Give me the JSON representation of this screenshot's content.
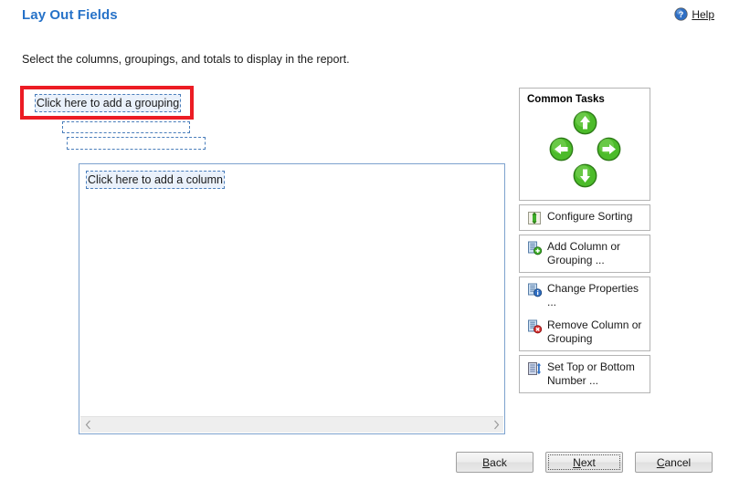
{
  "header": {
    "title": "Lay Out Fields",
    "help_label": "Help",
    "help_accel": "H",
    "help_icon": "help-circle-icon"
  },
  "instruction": "Select the columns, groupings, and totals to display in the report.",
  "designer": {
    "grouping_placeholder": "Click here to add a grouping",
    "grouping_empty_1": "",
    "grouping_empty_2": "",
    "column_placeholder": "Click here to add a column",
    "scroll_left_icon": "chevron-left-icon",
    "scroll_right_icon": "chevron-right-icon"
  },
  "annotation": {
    "color": "#ec1c24",
    "target": "grouping-placeholder"
  },
  "common_tasks": {
    "title": "Common Tasks",
    "arrows": [
      {
        "name": "move-up-button",
        "icon": "arrow-up-icon",
        "direction": "up"
      },
      {
        "name": "move-left-button",
        "icon": "arrow-left-icon",
        "direction": "left"
      },
      {
        "name": "move-right-button",
        "icon": "arrow-right-icon",
        "direction": "right"
      },
      {
        "name": "move-down-button",
        "icon": "arrow-down-icon",
        "direction": "down"
      }
    ],
    "items": [
      {
        "label": "Configure Sorting",
        "icon": "sort-icon"
      },
      {
        "label": "Add Column or Grouping ...",
        "icon": "add-column-icon"
      },
      {
        "label": "Change Properties ...",
        "icon": "properties-icon"
      },
      {
        "label": "Remove Column or Grouping",
        "icon": "remove-column-icon"
      },
      {
        "label": "Set Top or Bottom Number ...",
        "icon": "top-bottom-icon"
      }
    ]
  },
  "footer": {
    "back": {
      "label": "Back",
      "accel": "B",
      "rest": "ack",
      "focused": false
    },
    "next": {
      "label": "Next",
      "accel": "N",
      "rest": "ext",
      "focused": true
    },
    "cancel": {
      "label": "Cancel",
      "accel": "C",
      "rest": "ancel",
      "focused": false
    }
  },
  "colors": {
    "title_blue": "#2672c8",
    "accent_green": "#3fae2a",
    "panel_border": "#7da2ce",
    "annotation_red": "#ec1c24"
  }
}
